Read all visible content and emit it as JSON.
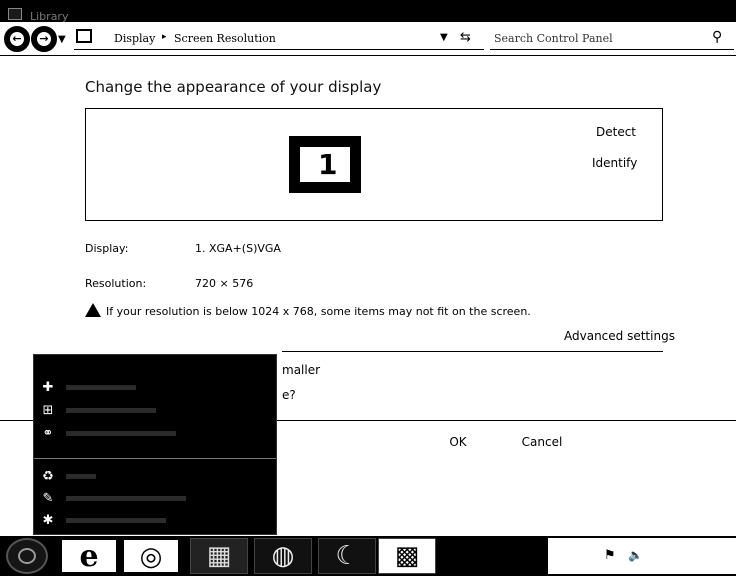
{
  "window": {
    "title": "Library"
  },
  "address_bar": {
    "breadcrumbs": [
      "Display",
      "Screen Resolution"
    ],
    "separator": "▸",
    "dropdown_icon": "chevron-down-icon",
    "refresh_icon": "refresh-icon"
  },
  "search": {
    "placeholder": "Search Control Panel",
    "icon": "search-icon"
  },
  "main": {
    "heading": "Change the appearance of your display",
    "monitor_number": "1",
    "detect_label": "Detect",
    "identify_label": "Identify",
    "display_label": "Display:",
    "display_value": "1. XGA+(S)VGA",
    "resolution_label": "Resolution:",
    "resolution_value": "720 × 576",
    "warning_text": "If your resolution is below 1024 x 768, some items may not fit on the screen.",
    "advanced_label": "Advanced settings",
    "partial_text_1": "maller",
    "partial_text_2": "e?",
    "ok_label": "OK",
    "cancel_label": "Cancel"
  },
  "start_menu": {
    "items": [
      {
        "icon": "add-icon"
      },
      {
        "icon": "window-icon"
      },
      {
        "icon": "network-icon"
      },
      {
        "icon": "recycle-icon"
      },
      {
        "icon": "tools-icon"
      },
      {
        "icon": "settings-icon"
      }
    ]
  },
  "taskbar": {
    "buttons": [
      {
        "icon": "internet-explorer-icon",
        "glyph": "e"
      },
      {
        "icon": "media-player-icon",
        "glyph": "◎"
      },
      {
        "icon": "explorer-icon",
        "glyph": "▦"
      },
      {
        "icon": "app-icon",
        "glyph": "◍"
      },
      {
        "icon": "moon-icon",
        "glyph": "☾"
      },
      {
        "icon": "control-panel-icon",
        "glyph": "▩"
      }
    ],
    "tray_icons": [
      "flag-icon",
      "speaker-icon"
    ]
  }
}
